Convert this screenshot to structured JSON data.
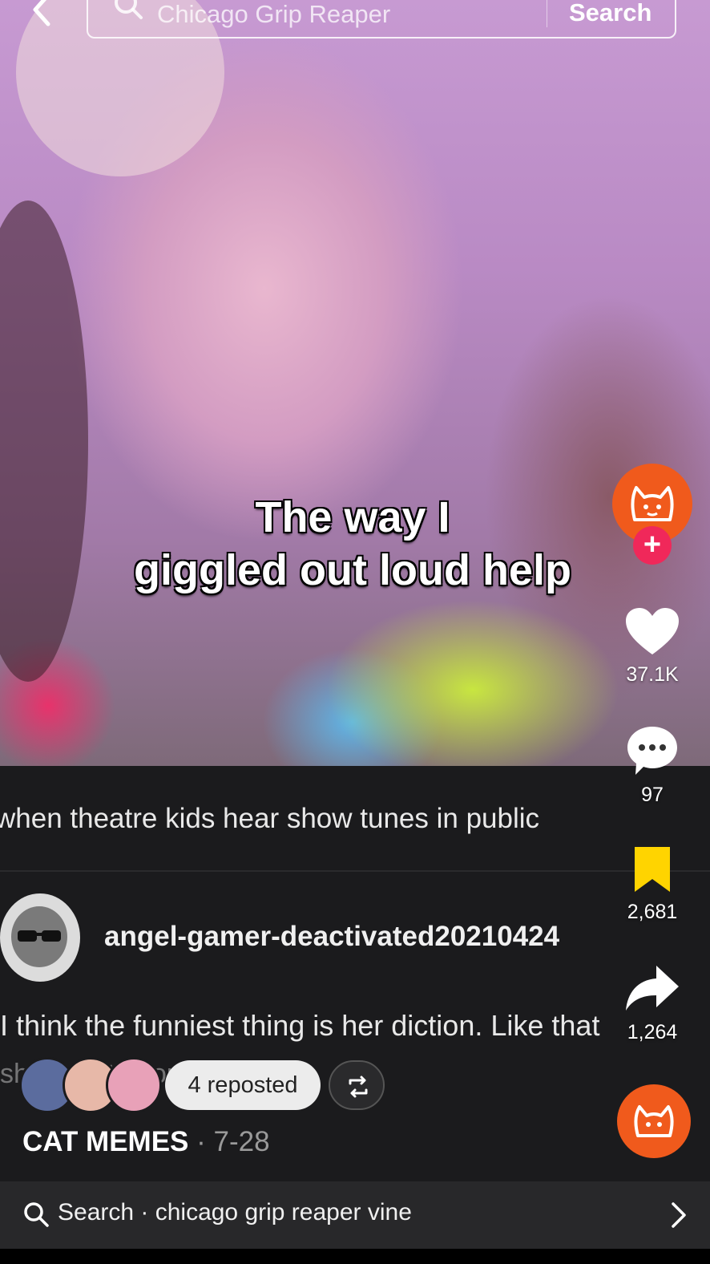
{
  "search": {
    "query": "Chicago Grip Reaper",
    "button_label": "Search"
  },
  "video": {
    "caption_line1": "The way I",
    "caption_line2": "giggled out loud help"
  },
  "post": {
    "title": "when theatre kids hear show tunes in public",
    "username": "angel-gamer-deactivated20210424",
    "comment": "I think the funniest thing is her diction. Like that",
    "comment_overflow": "sh... ...with you"
  },
  "repost": {
    "label": "4 reposted"
  },
  "channel": {
    "name": "CAT MEMES",
    "date": "· 7-28"
  },
  "actions": {
    "likes": "37.1K",
    "comments": "97",
    "saves": "2,681",
    "shares": "1,264"
  },
  "bottom_search": {
    "label": "Search · chicago grip reaper vine"
  },
  "colors": {
    "accent": "#f0285a",
    "profile": "#f05a1c",
    "bookmark": "#ffd400"
  }
}
